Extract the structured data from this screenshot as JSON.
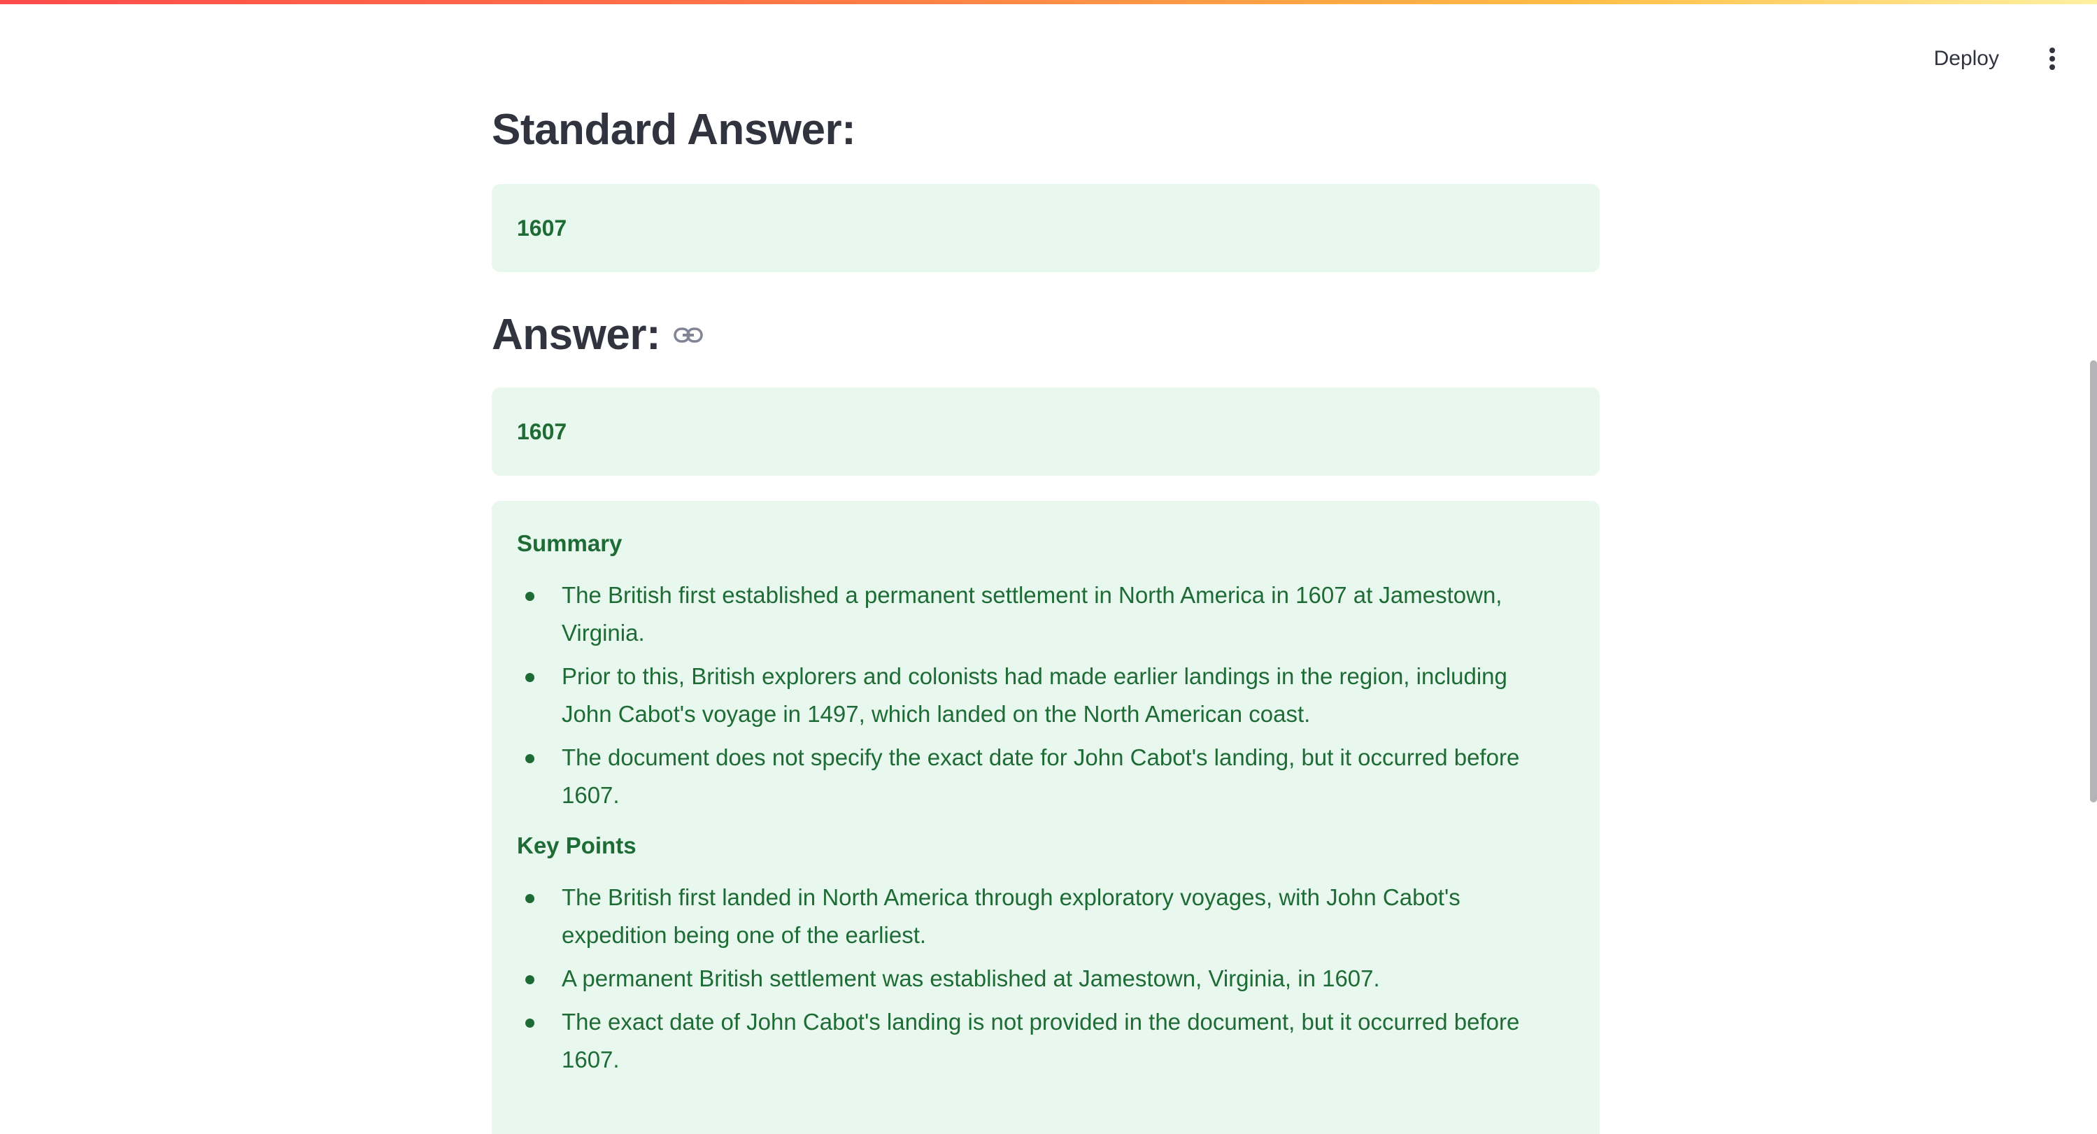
{
  "header": {
    "deploy_label": "Deploy",
    "menu_icon": "vertical-dots-icon"
  },
  "standard_answer": {
    "heading": "Standard Answer:",
    "value": "1607"
  },
  "answer": {
    "heading": "Answer:",
    "link_icon": "link-icon",
    "value": "1607"
  },
  "details": {
    "summary_heading": "Summary",
    "summary_items": [
      "The British first established a permanent settlement in North America in 1607 at Jamestown, Virginia.",
      "Prior to this, British explorers and colonists had made earlier landings in the region, including John Cabot's voyage in 1497, which landed on the North American coast.",
      "The document does not specify the exact date for John Cabot's landing, but it occurred before 1607."
    ],
    "key_points_heading": "Key Points",
    "key_points_items": [
      "The British first landed in North America through exploratory voyages, with John Cabot's expedition being one of the earliest.",
      "A permanent British settlement was established at Jamestown, Virginia, in 1607.",
      "The exact date of John Cabot's landing is not provided in the document, but it occurred before 1607."
    ]
  },
  "colors": {
    "success_bg": "#e8f8ee",
    "success_text": "#1e6b35",
    "heading_text": "#31333f"
  }
}
